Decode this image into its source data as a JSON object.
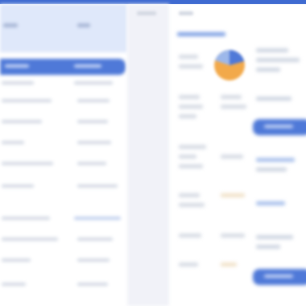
{
  "header": {
    "accent": "#3f6bd1"
  },
  "left_panel": {
    "selected_index": 0,
    "rows": [
      "",
      "",
      "",
      "",
      "",
      "",
      "",
      "",
      "",
      ""
    ]
  },
  "tabs": [
    "",
    ""
  ],
  "middle": {
    "chart_colors": [
      "#f2a94a",
      "#4f79d8"
    ],
    "items": [
      "",
      "",
      "",
      "",
      "",
      "",
      "",
      "",
      "",
      ""
    ]
  },
  "right": {
    "buttons": [
      "",
      ""
    ],
    "lines": [
      "",
      "",
      "",
      "",
      "",
      "",
      "",
      ""
    ]
  },
  "colors": {
    "primary": "#4f79d8",
    "header_bg": "#dfe8fa",
    "chart_orange": "#f2a94a"
  }
}
